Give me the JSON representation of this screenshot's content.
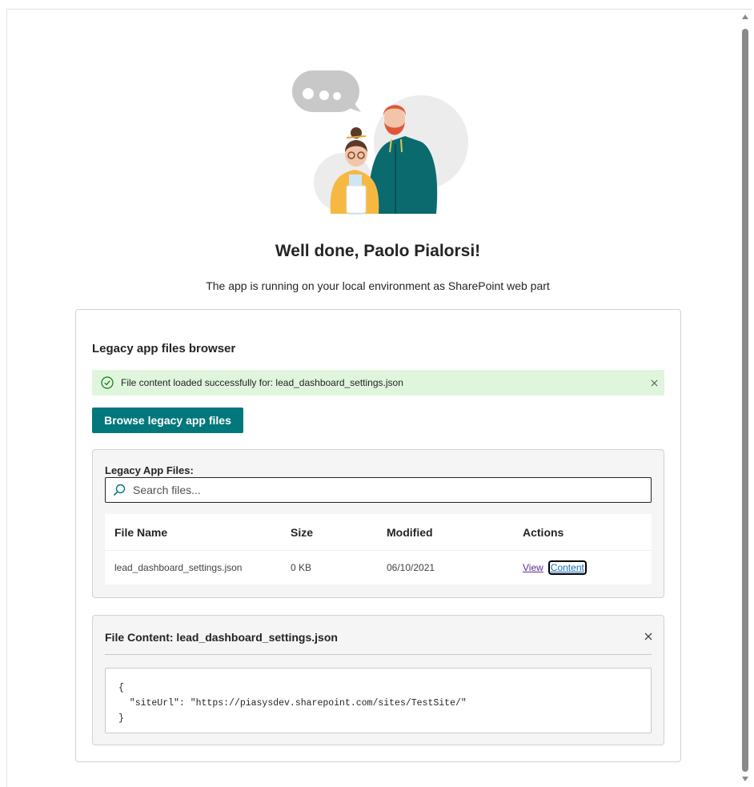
{
  "page": {
    "headline": "Well done, Paolo Pialorsi!",
    "subtitle": "The app is running on your local environment as SharePoint web part"
  },
  "webpart": {
    "title": "Legacy app files browser",
    "message": {
      "type": "success",
      "icon": "checkmark-circle-icon",
      "text": "File content loaded successfully for: lead_dashboard_settings.json",
      "dismiss_icon": "close-icon"
    },
    "browse_button": "Browse legacy app files",
    "files_panel": {
      "label": "Legacy App Files:",
      "search_placeholder": "Search files...",
      "columns": [
        "File Name",
        "Size",
        "Modified",
        "Actions"
      ],
      "rows": [
        {
          "name": "lead_dashboard_settings.json",
          "size": "0 KB",
          "modified": "06/10/2021",
          "actions": [
            "View",
            "Content"
          ]
        }
      ]
    },
    "content_panel": {
      "title": "File Content: lead_dashboard_settings.json",
      "close_icon": "close-icon",
      "content": "{\n  \"siteUrl\": \"https://piasysdev.sharepoint.com/sites/TestSite/\"\n}"
    }
  },
  "colors": {
    "accent": "#03787c",
    "success_bg": "#dff6dd",
    "success_icon": "#107c10",
    "visited_link": "#5c2d91"
  }
}
